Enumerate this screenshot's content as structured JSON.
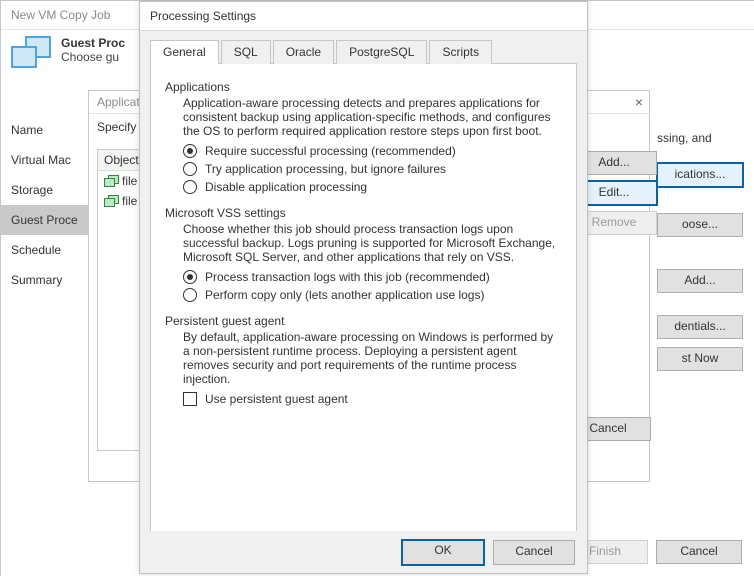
{
  "wizard": {
    "title": "New VM Copy Job",
    "heading": "Guest Proc",
    "sub": "Choose gu",
    "nav": [
      "Name",
      "Virtual Mac",
      "Storage",
      "Guest Proce",
      "Schedule",
      "Summary"
    ],
    "nav_active": 3,
    "finish": "Finish",
    "cancel": "Cancel"
  },
  "apps_dialog": {
    "title": "Applicati",
    "specify": "Specify",
    "col_header": "Object",
    "rows": [
      "file",
      "file"
    ],
    "buttons": {
      "add": "Add...",
      "edit": "Edit...",
      "remove": "Remove"
    },
    "cancel": "Cancel"
  },
  "right_buttons": {
    "r1": "ssing, and",
    "applications": "ications...",
    "choose": "oose...",
    "add": "Add...",
    "credentials": "dentials...",
    "test_now": "st Now"
  },
  "dialog": {
    "title": "Processing Settings",
    "tabs": [
      "General",
      "SQL",
      "Oracle",
      "PostgreSQL",
      "Scripts"
    ],
    "active_tab": 0,
    "applications": {
      "title": "Applications",
      "desc": "Application-aware processing detects and prepares applications for consistent backup using application-specific methods, and configures the OS to perform required application restore steps upon first boot.",
      "opts": [
        "Require successful processing (recommended)",
        "Try application processing, but ignore failures",
        "Disable application processing"
      ],
      "selected": 0
    },
    "vss": {
      "title": "Microsoft VSS settings",
      "desc": "Choose whether this job should process transaction logs upon successful backup. Logs pruning is supported for Microsoft Exchange, Microsoft SQL Server, and other applications that rely on VSS.",
      "opts": [
        "Process transaction logs with this job (recommended)",
        "Perform copy only (lets another application use logs)"
      ],
      "selected": 0
    },
    "agent": {
      "title": "Persistent guest agent",
      "desc": "By default, application-aware processing on Windows is performed by a non-persistent runtime process. Deploying a persistent agent removes security and port requirements of the runtime process injection.",
      "check": "Use persistent guest agent",
      "checked": false
    },
    "ok": "OK",
    "cancel": "Cancel"
  }
}
